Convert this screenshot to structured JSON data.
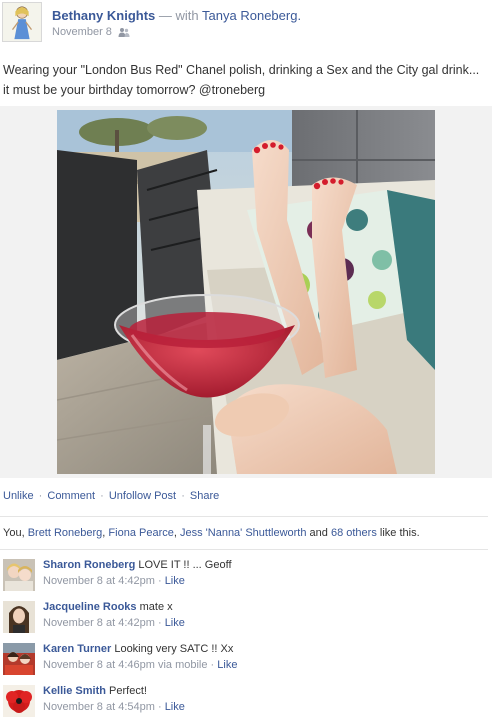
{
  "post": {
    "author_name": "Bethany Knights",
    "with_text": "— with",
    "tagged_name": "Tanya Roneberg.",
    "timestamp": "November 8",
    "audience_icon": "friends-icon",
    "status": "Wearing your \"London Bus Red\" Chanel polish, drinking a Sex and the City gal drink... it must be your birthday tomorrow? @troneberg"
  },
  "actions": {
    "unlike": "Unlike",
    "comment": "Comment",
    "unfollow": "Unfollow Post",
    "share": "Share",
    "separator": "·"
  },
  "likes": {
    "you": "You,",
    "names": [
      "Brett Roneberg",
      "Fiona Pearce",
      "Jess 'Nanna' Shuttleworth"
    ],
    "name_sep_1": ",",
    "name_sep_2": ",",
    "and_text": "and",
    "others_link": "68 others",
    "suffix": "like this."
  },
  "comments": [
    {
      "author": "Sharon Roneberg",
      "text": "LOVE IT !! ... Geoff",
      "time": "November 8 at 4:42pm",
      "via": "",
      "like_label": "Like"
    },
    {
      "author": "Jacqueline Rooks",
      "text": "mate x",
      "time": "November 8 at 4:42pm",
      "via": "",
      "like_label": "Like"
    },
    {
      "author": "Karen Turner",
      "text": "Looking very SATC !! Xx",
      "time": "November 8 at 4:46pm",
      "via": "via mobile",
      "like_label": "Like"
    },
    {
      "author": "Kellie Smith",
      "text": "Perfect!",
      "time": "November 8 at 4:54pm",
      "via": "",
      "like_label": "Like"
    }
  ],
  "colors": {
    "link_blue": "#3b5998",
    "meta_grey": "#9197a3",
    "cocktail_red": "#c8283c",
    "polish_red": "#d41c2c"
  }
}
